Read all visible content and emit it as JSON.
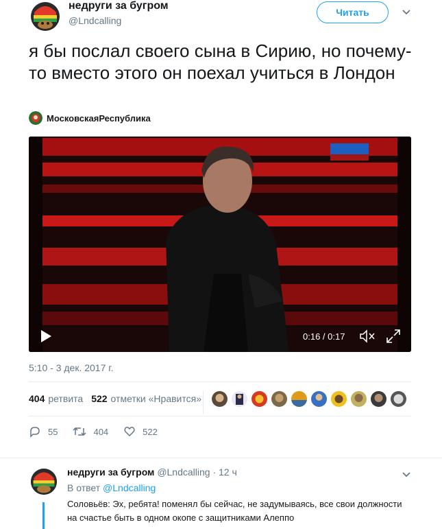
{
  "author": {
    "display_name": "недруги за бугром",
    "handle": "@Lndcalling"
  },
  "follow_button": "Читать",
  "tweet_text": "я бы послал своего сына в Сирию, но почему-то вместо этого он поехал учиться в Лондон",
  "source": {
    "name": "МосковскаяРеспублика"
  },
  "video": {
    "time": "0:16 / 0:17",
    "progress": 0.94,
    "icons": [
      "play-icon",
      "mute-icon",
      "fullscreen-icon"
    ]
  },
  "timestamp": "5:10 - 3 дек. 2017 г.",
  "stats": {
    "retweets_count": "404",
    "retweets_label": "ретвита",
    "likes_count": "522",
    "likes_label": "отметки «Нравится»"
  },
  "actions": {
    "reply_count": "55",
    "retweet_count": "404",
    "like_count": "522"
  },
  "reply": {
    "display_name": "недруги за бугром",
    "handle": "@Lndcalling",
    "time": "· 12 ч",
    "in_reply_prefix": "В ответ",
    "in_reply_handle": "@Lndcalling",
    "text": "Соловьёв: Эх, ребята! поменял бы сейчас, не задумываясь, все свои должности на счастье быть в одном окопе с защитниками Алеппо"
  },
  "colors": {
    "accent": "#1da1f2",
    "muted": "#657786",
    "text": "#14171a",
    "divider": "#e6ecf0"
  }
}
